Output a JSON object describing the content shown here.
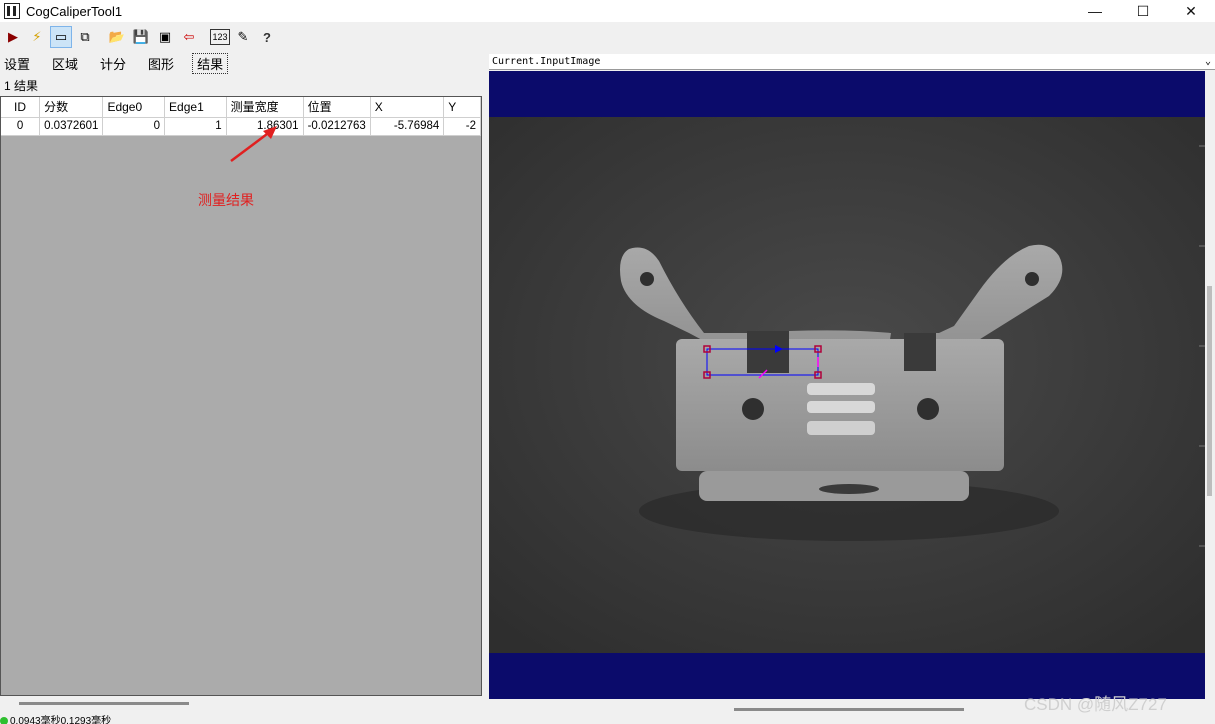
{
  "window": {
    "title": "CogCaliperTool1",
    "minimize": "—",
    "maximize": "☐",
    "close": "✕"
  },
  "toolbar": {
    "icons": [
      "run-icon",
      "flash-icon",
      "display-icon",
      "copy-icon",
      "open-icon",
      "save-icon",
      "image-grab-icon",
      "import-icon",
      "numbers-icon",
      "pen-icon",
      "help-icon"
    ],
    "glyphs": [
      "▶",
      "⚡",
      "▭",
      "⧉",
      "📂",
      "💾",
      "▣",
      "⇦",
      "123",
      "✎",
      "?"
    ]
  },
  "tabs": [
    "设置",
    "区域",
    "计分",
    "图形",
    "结果"
  ],
  "selected_tab": "结果",
  "results_label": "1 结果",
  "grid": {
    "columns": [
      "ID",
      "分数",
      "Edge0",
      "Edge1",
      "测量宽度",
      "位置",
      "X",
      "Y"
    ],
    "rows": [
      [
        "0",
        "0.0372601",
        "0",
        "1",
        "1.86301",
        "-0.0212763",
        "-5.76984",
        "-2"
      ]
    ]
  },
  "annotation": {
    "text": "测量结果",
    "color": "#e02020"
  },
  "status": {
    "text": "0.0943毫秒0.1293毫秒"
  },
  "image_pane": {
    "header": "Current.InputImage",
    "dropdown": "⌄",
    "background": "#0b0b6b"
  },
  "watermark": "CSDN @随风Z727"
}
